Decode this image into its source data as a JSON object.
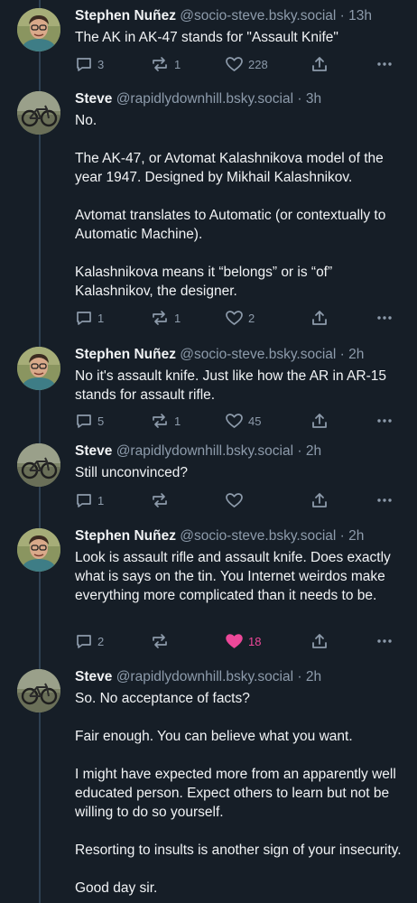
{
  "posts": [
    {
      "name": "Stephen Nuñez",
      "handle": "@socio-steve.bsky.social",
      "time": "· 13h",
      "paragraphs": [
        "The AK in AK-47 stands for \"Assault Knife\""
      ],
      "replies": "3",
      "reposts": "1",
      "likes": "228",
      "liked": false
    },
    {
      "name": "Steve",
      "handle": "@rapidlydownhill.bsky.social",
      "time": "· 3h",
      "paragraphs": [
        "No.",
        "The AK-47, or Avtomat Kalashnikova model of the year 1947. Designed by Mikhail Kalashnikov.",
        "Avtomat translates to Automatic (or contextually to Automatic Machine).",
        "Kalashnikova means it “belongs” or is “of” Kalashnikov, the designer."
      ],
      "replies": "1",
      "reposts": "1",
      "likes": "2",
      "liked": false
    },
    {
      "name": "Stephen Nuñez",
      "handle": "@socio-steve.bsky.social",
      "time": "· 2h",
      "paragraphs": [
        "No it's assault knife. Just like how the AR in AR-15 stands for assault rifle."
      ],
      "replies": "5",
      "reposts": "1",
      "likes": "45",
      "liked": false
    },
    {
      "name": "Steve",
      "handle": "@rapidlydownhill.bsky.social",
      "time": "· 2h",
      "paragraphs": [
        "Still unconvinced?"
      ],
      "replies": "1",
      "reposts": "",
      "likes": "",
      "liked": false
    },
    {
      "name": "Stephen Nuñez",
      "handle": "@socio-steve.bsky.social",
      "time": "· 2h",
      "paragraphs": [
        "Look is assault rifle and assault knife. Does exactly what is says on the tin. You Internet weirdos make everything more complicated than it needs to be."
      ],
      "replies": "2",
      "reposts": "",
      "likes": "18",
      "liked": true
    },
    {
      "name": "Steve",
      "handle": "@rapidlydownhill.bsky.social",
      "time": "· 2h",
      "paragraphs": [
        "So.  No acceptance of facts?",
        "Fair enough.  You can believe what you want.",
        "I might have expected more from an apparently well educated person. Expect others to learn but not be willing to do so yourself.",
        "Resorting to insults is another sign of your insecurity.",
        "Good day sir."
      ],
      "replies": "",
      "reposts": "",
      "likes": "",
      "liked": false
    }
  ],
  "icons": {
    "reply": "reply-icon",
    "repost": "repost-icon",
    "like": "heart-icon",
    "share": "share-icon",
    "more": "more-options-icon"
  },
  "colors": {
    "background": "#161e27",
    "text": "#f1f3f5",
    "muted": "#8d9bab",
    "thread_line": "#2e4052",
    "like_active": "#ec4899"
  }
}
